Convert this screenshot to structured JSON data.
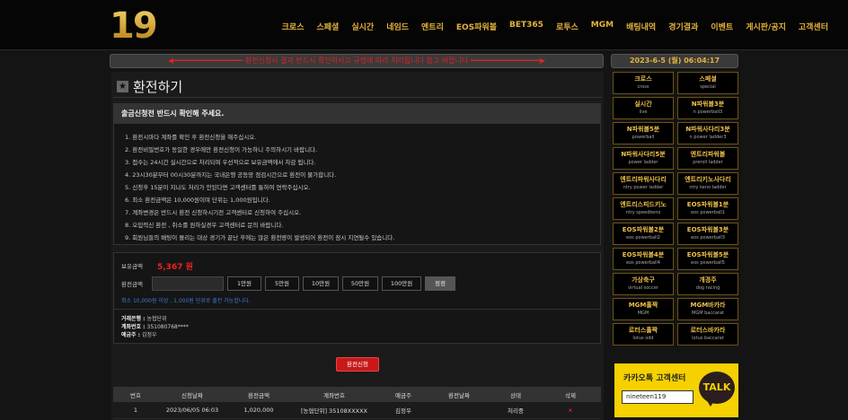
{
  "header": {
    "logo": "19",
    "nav": [
      "크로스",
      "스페셜",
      "실시간",
      "네임드",
      "엔트리",
      "EOS파워볼",
      "BET365",
      "로투스",
      "MGM",
      "배팅내역",
      "경기결과",
      "이벤트",
      "게시판/공지",
      "고객센터"
    ]
  },
  "marquee": "◀━━━━━━━━━━━━━━━━  환전신청시 결과 반드시 확인하시고 규정에 따라 처리됩니다 참고 바랍니다  ━━━━━━━━━━━━━━━━▶",
  "clock": "2023-6-5 (월) 06:04:17",
  "page": {
    "title": "환전하기",
    "notice_heading": "출금신청전 반드시 확인해 주세요.",
    "notices": [
      "1. 환전시마다 계좌를 확인 후 환전신청을 해주십시오.",
      "2. 환전비밀번호가 동일한 경우에만 환전신청이 가능하니 주의하시기 바랍니다.",
      "3. 접수는 24시간 실시간으로 처리되며 우선적으로 보유금액에서 차감 됩니다.",
      "4. 23시30분부터 00시30분까지는 국내은행 공동망 점검시간으로 환전이 불가합니다.",
      "5. 신청후 15분이 지나도 처리가 안된다면 고객센터를 통하여 연락주십시오.",
      "6. 최소 환전금액은 10,000원이며 단위는 1,000원입니다.",
      "7. 계좌변경은 반드시 환전 신청하시기전 고객센터로 신청하여 주십시오.",
      "8. 오입력신 환전 , 취소를 원하실경우 고객센터로 문의 바랍니다.",
      "9. 회원님들의 배팅이 몰리는 대상 경기가 끝난 후에는 많은 환전량이 발생되어 환전이 잠시 지연될수 있습니다."
    ],
    "balance_label": "보유금액",
    "balance_value": "5,367 원",
    "amount_label": "환전금액",
    "amount_buttons": [
      "1만원",
      "5만원",
      "10만원",
      "50만원",
      "100만원"
    ],
    "reset_label": "정정",
    "info_text": "최소 10,000원 이상 , 1,000원 단위로 출전 가능합니다.",
    "bank": {
      "bank_label": "거래은행 :",
      "bank_value": "농협단위",
      "account_label": "계좌번호 :",
      "account_value": "351080768****",
      "holder_label": "예금주 :",
      "holder_value": "김정우"
    },
    "apply_label": "환전신청",
    "table": {
      "headers": [
        "번호",
        "신청날짜",
        "환전금액",
        "계좌번호",
        "예금주",
        "환전날짜",
        "상태",
        "삭제"
      ],
      "rows": [
        [
          "1",
          "2023/06/05 06:03",
          "1,020,000",
          "[농협단위] 35108XXXXX",
          "김정우",
          "",
          "처리중",
          "×"
        ]
      ]
    }
  },
  "sidebar": {
    "games": [
      {
        "name": "크로스",
        "sub": "cross"
      },
      {
        "name": "스페셜",
        "sub": "special"
      },
      {
        "name": "실시간",
        "sub": "live"
      },
      {
        "name": "N파워볼3분",
        "sub": "n powerball3"
      },
      {
        "name": "N파워볼5분",
        "sub": "powerball"
      },
      {
        "name": "N파워사다리3분",
        "sub": "n power ladder3"
      },
      {
        "name": "N파워사다리5분",
        "sub": "power ladder"
      },
      {
        "name": "엔트리파워볼",
        "sub": "preroll ladder"
      },
      {
        "name": "엔트리파워사다리",
        "sub": "ntry power ladder"
      },
      {
        "name": "엔트리키노사다리",
        "sub": "ntry keno ladder"
      },
      {
        "name": "엔트리스피드키노",
        "sub": "ntry speedkeno"
      },
      {
        "name": "EOS파워볼1분",
        "sub": "eos powerball1"
      },
      {
        "name": "EOS파워볼2분",
        "sub": "eos powerball2"
      },
      {
        "name": "EOS파워볼3분",
        "sub": "eos powerball3"
      },
      {
        "name": "EOS파워볼4분",
        "sub": "eos powerball4"
      },
      {
        "name": "EOS파워볼5분",
        "sub": "eos powerball5"
      },
      {
        "name": "가상축구",
        "sub": "virtual soccer"
      },
      {
        "name": "개경주",
        "sub": "dog racing"
      },
      {
        "name": "MGM홀짝",
        "sub": "MGM"
      },
      {
        "name": "MGM바카라",
        "sub": "MGM baccarat"
      },
      {
        "name": "로터스홀짝",
        "sub": "lotus odd"
      },
      {
        "name": "로터스바카라",
        "sub": "lotus baccarat"
      }
    ],
    "kakao": {
      "title": "카카오톡 고객센터",
      "id": "nineteen119",
      "talk": "TALK"
    }
  }
}
